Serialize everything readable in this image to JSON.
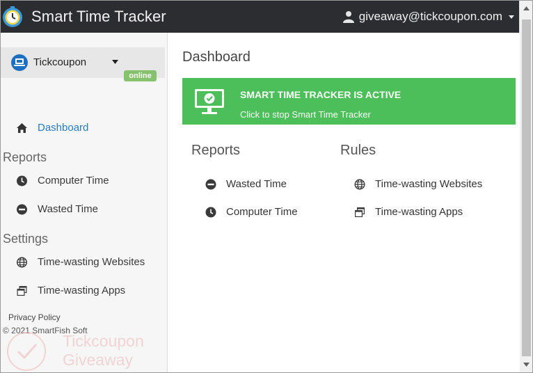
{
  "app": {
    "title": "Smart Time Tracker",
    "user_email": "giveaway@tickcoupon.com"
  },
  "device": {
    "name": "Tickcoupon",
    "status": "online"
  },
  "sidebar": {
    "dashboard_label": "Dashboard",
    "reports_heading": "Reports",
    "reports_items": [
      "Computer Time",
      "Wasted Time"
    ],
    "settings_heading": "Settings",
    "settings_items": [
      "Time-wasting Websites",
      "Time-wasting Apps"
    ],
    "privacy_label": "Privacy Policy",
    "copyright": "© 2021 SmartFish Soft"
  },
  "main": {
    "page_title": "Dashboard",
    "banner": {
      "title": "SMART TIME TRACKER IS ACTIVE",
      "subtitle": "Click to stop Smart Time Tracker"
    },
    "reports": {
      "heading": "Reports",
      "items": [
        "Wasted Time",
        "Computer Time"
      ]
    },
    "rules": {
      "heading": "Rules",
      "items": [
        "Time-wasting Websites",
        "Time-wasting Apps"
      ]
    }
  },
  "watermark": {
    "line1": "Tickcoupon",
    "line2": "Giveaway"
  },
  "colors": {
    "topbar": "#2b2d30",
    "accent_blue": "#2a7bbf",
    "active_green": "#4cbe5a",
    "online_badge": "#86c26e"
  },
  "icons": {
    "app_logo": "stopwatch-icon",
    "user": "user-icon",
    "device": "laptop-icon",
    "dashboard": "home-icon",
    "computer_time": "clock-icon",
    "wasted_time": "minus-circle-icon",
    "websites": "globe-icon",
    "apps": "windows-icon",
    "banner": "monitor-check-icon"
  }
}
